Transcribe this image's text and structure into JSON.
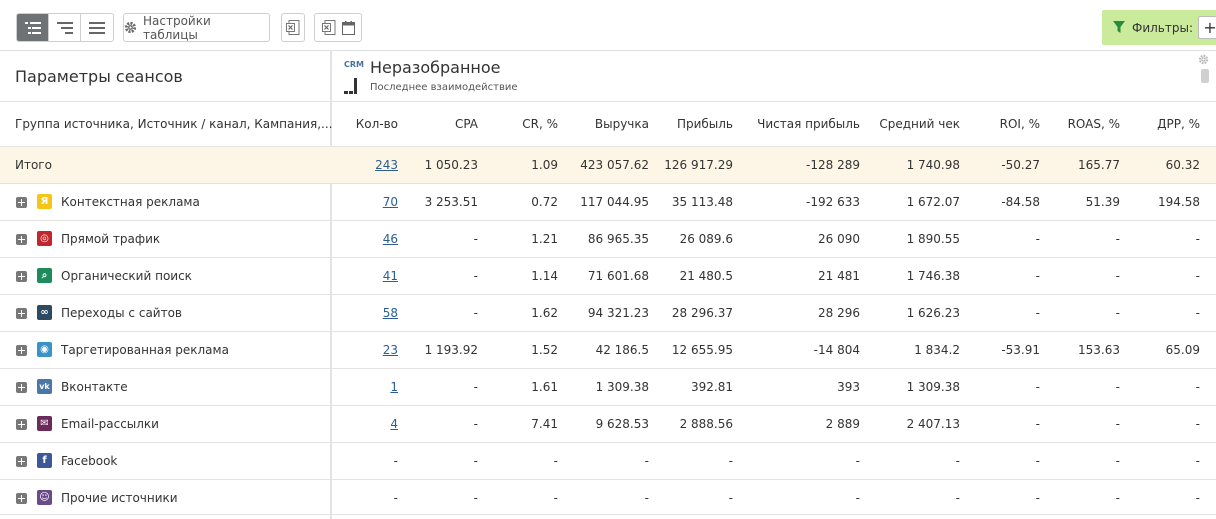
{
  "toolbar": {
    "settings_label": "Настройки таблицы",
    "filters_label": "Фильтры:",
    "filters_add": "+"
  },
  "panel": {
    "params_title": "Параметры сеансов",
    "crm_badge": "CRM",
    "section_title": "Неразобранное",
    "section_subtitle": "Последнее взаимодействие"
  },
  "table": {
    "name_header": "Группа источника, Источник / канал, Кампания,...",
    "columns": [
      "Кол-во",
      "CPA",
      "CR, %",
      "Выручка",
      "Прибыль",
      "Чистая прибыль",
      "Средний чек",
      "ROI, %",
      "ROAS, %",
      "ДРР, %"
    ],
    "total": {
      "name": "Итого",
      "values": [
        "243",
        "1 050.23",
        "1.09",
        "423 057.62",
        "126 917.29",
        "-128 289",
        "1 740.98",
        "-50.27",
        "165.77",
        "60.32"
      ]
    },
    "rows": [
      {
        "name": "Контекстная реклама",
        "icon": "yandex-direct-icon",
        "icon_color": "#f5c518",
        "icon_glyph": "Я",
        "values": [
          "70",
          "3 253.51",
          "0.72",
          "117 044.95",
          "35 113.48",
          "-192 633",
          "1 672.07",
          "-84.58",
          "51.39",
          "194.58"
        ]
      },
      {
        "name": "Прямой трафик",
        "icon": "direct-traffic-icon",
        "icon_color": "#c0282d",
        "icon_glyph": "◎",
        "values": [
          "46",
          "-",
          "1.21",
          "86 965.35",
          "26 089.6",
          "26 090",
          "1 890.55",
          "-",
          "-",
          "-"
        ]
      },
      {
        "name": "Органический поиск",
        "icon": "search-icon",
        "icon_color": "#1f8a5a",
        "icon_glyph": "⌕",
        "values": [
          "41",
          "-",
          "1.14",
          "71 601.68",
          "21 480.5",
          "21 481",
          "1 746.38",
          "-",
          "-",
          "-"
        ]
      },
      {
        "name": "Переходы с сайтов",
        "icon": "link-icon",
        "icon_color": "#2d4a63",
        "icon_glyph": "∞",
        "values": [
          "58",
          "-",
          "1.62",
          "94 321.23",
          "28 296.37",
          "28 296",
          "1 626.23",
          "-",
          "-",
          "-"
        ]
      },
      {
        "name": "Таргетированная реклама",
        "icon": "target-icon",
        "icon_color": "#3a93c8",
        "icon_glyph": "◉",
        "values": [
          "23",
          "1 193.92",
          "1.52",
          "42 186.5",
          "12 655.95",
          "-14 804",
          "1 834.2",
          "-53.91",
          "153.63",
          "65.09"
        ]
      },
      {
        "name": "Вконтакте",
        "icon": "vk-icon",
        "icon_color": "#4a76a8",
        "icon_glyph": "vk",
        "values": [
          "1",
          "-",
          "1.61",
          "1 309.38",
          "392.81",
          "393",
          "1 309.38",
          "-",
          "-",
          "-"
        ]
      },
      {
        "name": "Email-рассылки",
        "icon": "email-icon",
        "icon_color": "#6b2a5a",
        "icon_glyph": "✉",
        "values": [
          "4",
          "-",
          "7.41",
          "9 628.53",
          "2 888.56",
          "2 889",
          "2 407.13",
          "-",
          "-",
          "-"
        ]
      },
      {
        "name": "Facebook",
        "icon": "facebook-icon",
        "icon_color": "#3b5998",
        "icon_glyph": "f",
        "values": [
          "-",
          "-",
          "-",
          "-",
          "-",
          "-",
          "-",
          "-",
          "-",
          "-"
        ]
      },
      {
        "name": "Прочие источники",
        "icon": "other-sources-icon",
        "icon_color": "#6a4a8a",
        "icon_glyph": "☺",
        "values": [
          "-",
          "-",
          "-",
          "-",
          "-",
          "-",
          "-",
          "-",
          "-",
          "-"
        ]
      }
    ]
  }
}
